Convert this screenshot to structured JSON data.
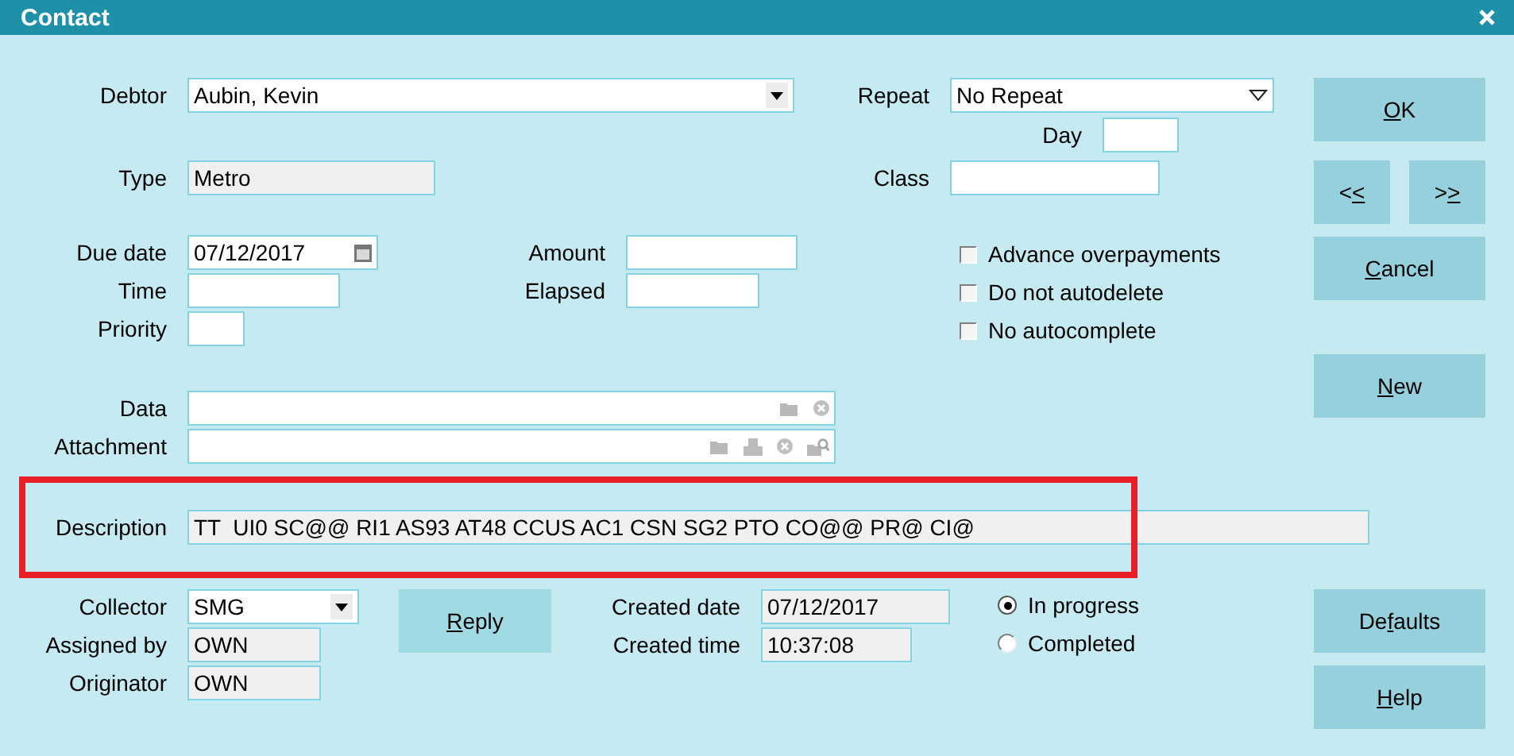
{
  "window": {
    "title": "Contact"
  },
  "fields": {
    "debtor": {
      "label": "Debtor",
      "value": "Aubin, Kevin",
      "kind": "combo",
      "read_only": false
    },
    "repeat": {
      "label": "Repeat",
      "value": "No Repeat",
      "kind": "list",
      "read_only": false
    },
    "day": {
      "label": "Day",
      "read_only": false
    },
    "type": {
      "label": "Type",
      "value": "Metro",
      "read_only": true
    },
    "class": {
      "label": "Class",
      "read_only": false
    },
    "due_date": {
      "label": "Due date",
      "value": "07/12/2017",
      "kind": "date",
      "read_only": false
    },
    "amount": {
      "label": "Amount",
      "read_only": false
    },
    "time": {
      "label": "Time",
      "read_only": false
    },
    "elapsed": {
      "label": "Elapsed",
      "read_only": false
    },
    "priority": {
      "label": "Priority",
      "read_only": false
    },
    "data": {
      "label": "Data",
      "kind": "file",
      "read_only": false
    },
    "attachment": {
      "label": "Attachment",
      "kind": "attachment",
      "read_only": false
    },
    "description": {
      "label": "Description",
      "value": "TT  UI0 SC@@ RI1 AS93 AT48 CCUS AC1 CSN SG2 PTO CO@@ PR@ CI@",
      "read_only": true
    },
    "collector": {
      "label": "Collector",
      "value": "SMG",
      "kind": "combo",
      "read_only": false
    },
    "assigned_by": {
      "label": "Assigned by",
      "value": "OWN",
      "read_only": true
    },
    "originator": {
      "label": "Originator",
      "value": "OWN",
      "read_only": true
    },
    "created_date": {
      "label": "Created date",
      "value": "07/12/2017",
      "read_only": true
    },
    "created_time": {
      "label": "Created time",
      "value": "10:37:08",
      "read_only": true
    }
  },
  "checkboxes": [
    {
      "label": "Advance overpayments",
      "checked": false
    },
    {
      "label": "Do not autodelete",
      "checked": false
    },
    {
      "label": "No autocomplete",
      "checked": false
    }
  ],
  "status_radios": [
    {
      "label": "In progress",
      "selected": true
    },
    {
      "label": "Completed",
      "selected": false
    }
  ],
  "annotation": {
    "kind": "frame"
  },
  "buttons": {
    "ok": {
      "mnemonic": "O",
      "after": "K"
    },
    "prev": {
      "before": "<",
      "mnemonic": "<"
    },
    "next": {
      "before": ">",
      "mnemonic": ">"
    },
    "cancel": {
      "mnemonic": "C",
      "after": "ancel"
    },
    "new": {
      "mnemonic": "N",
      "after": "ew"
    },
    "reply": {
      "mnemonic": "R",
      "after": "eply"
    },
    "defaults": {
      "before": "De",
      "mnemonic": "f",
      "after": "aults"
    },
    "help": {
      "mnemonic": "H",
      "after": "elp"
    }
  }
}
